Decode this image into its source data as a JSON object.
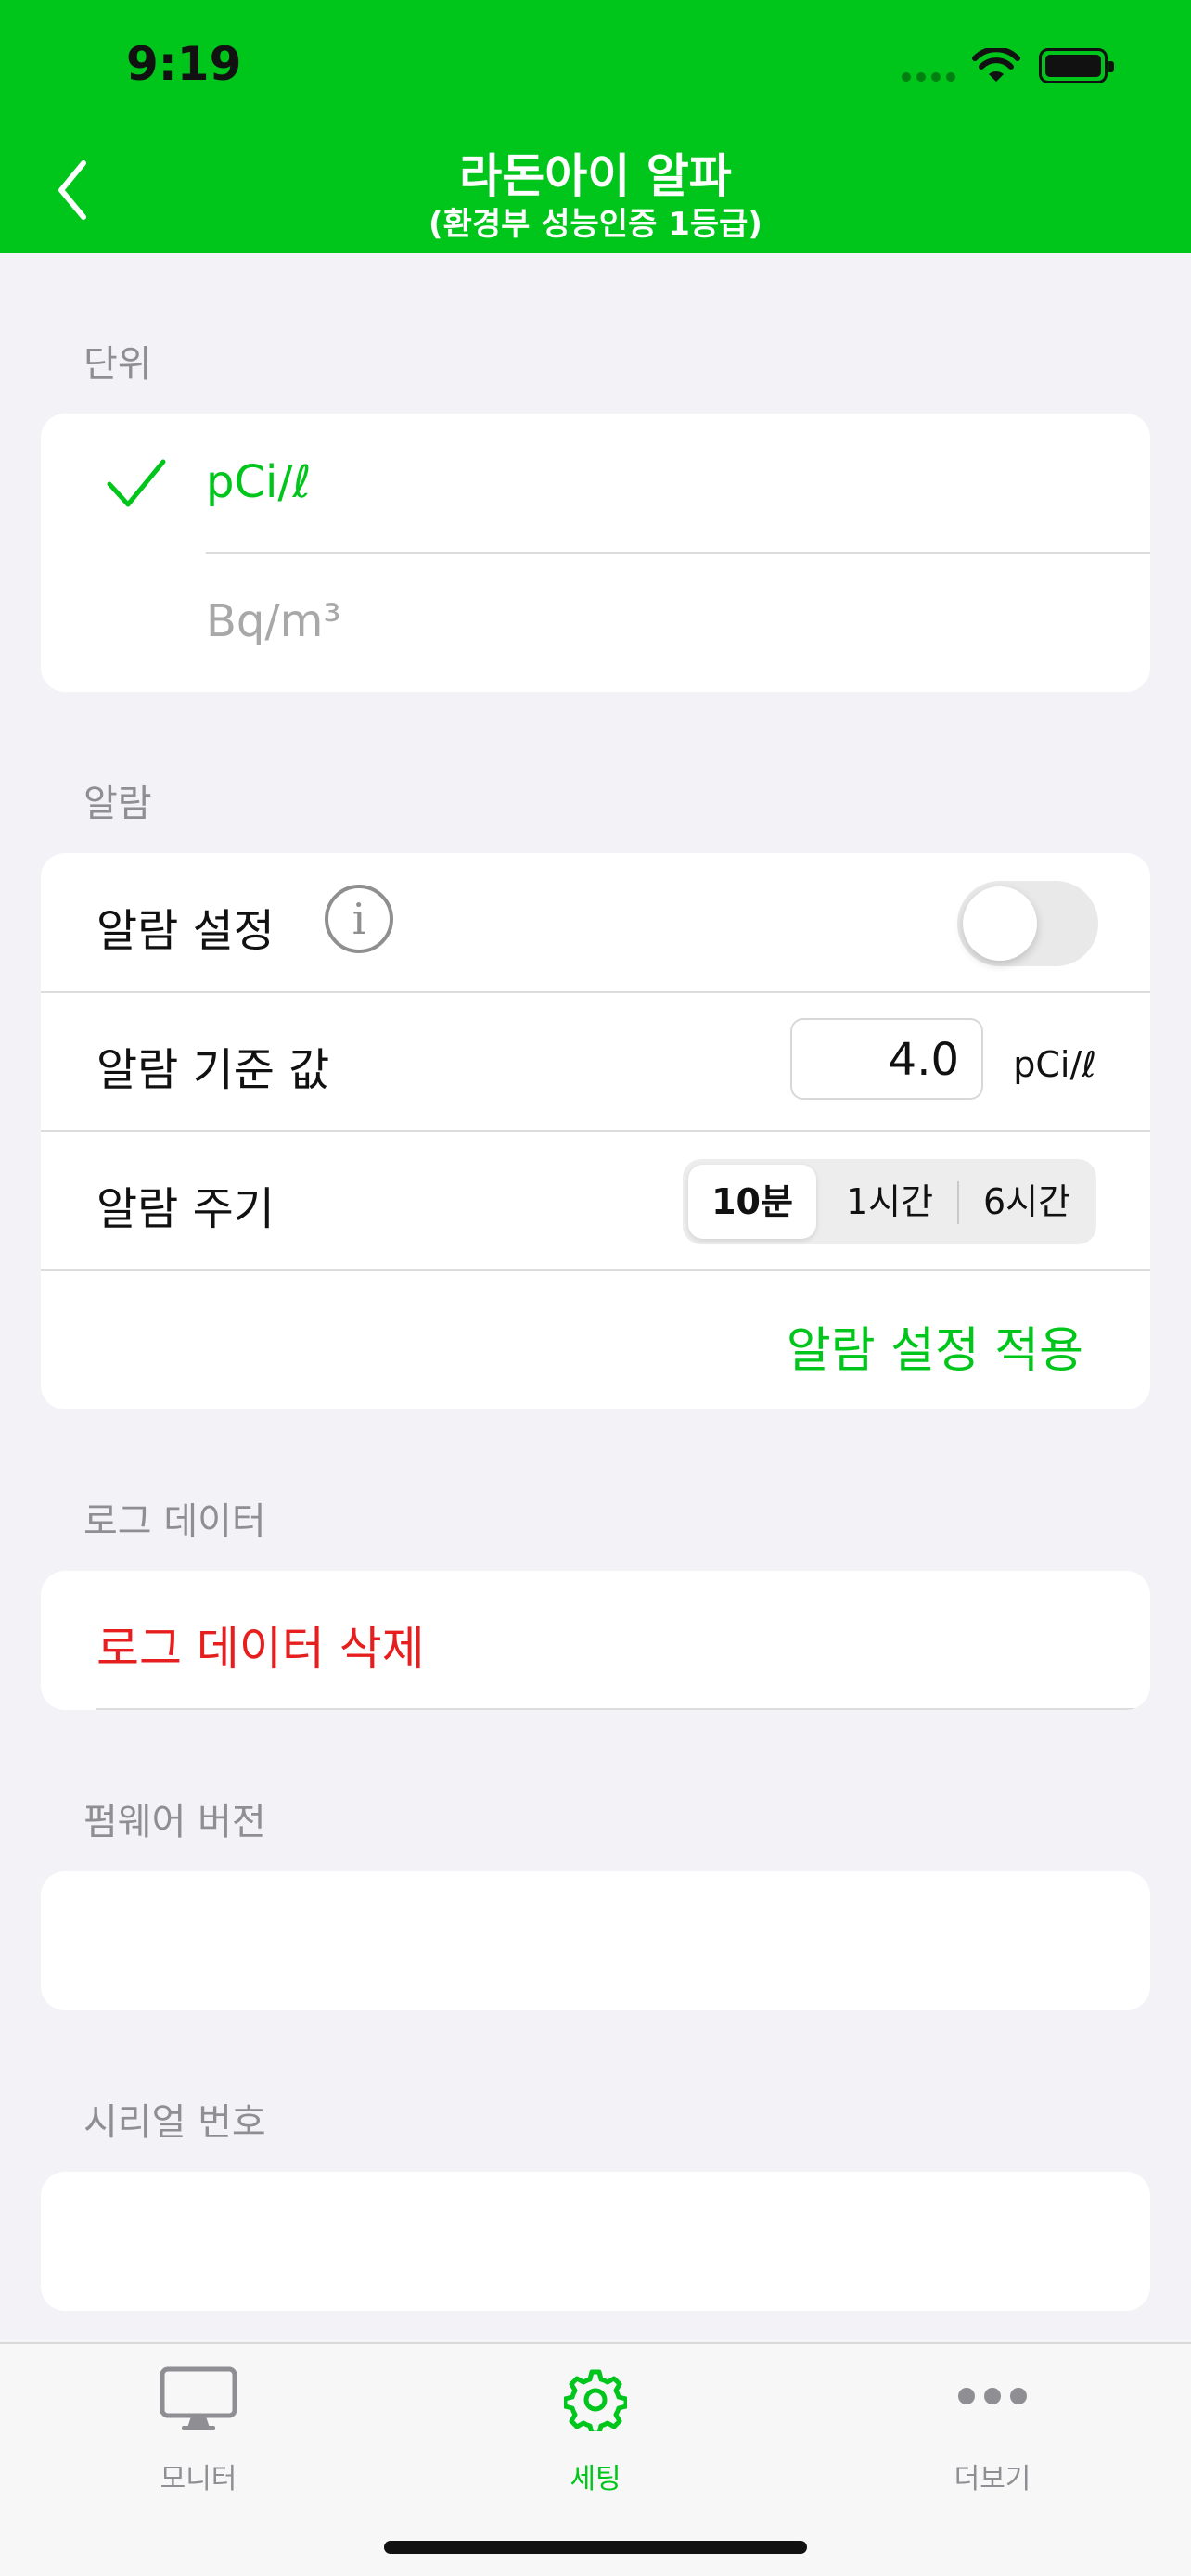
{
  "status_bar": {
    "time": "9:19"
  },
  "header": {
    "title": "라돈아이 알파",
    "subtitle": "(환경부 성능인증 1등급)"
  },
  "sections": {
    "unit": {
      "label": "단위",
      "options": [
        {
          "label": "pCi/ℓ",
          "selected": true
        },
        {
          "label": "Bq/m³",
          "selected": false
        }
      ]
    },
    "alarm": {
      "label": "알람",
      "setting_label": "알람 설정",
      "setting_on": false,
      "threshold_label": "알람 기준 값",
      "threshold_value": "4.0",
      "threshold_unit": "pCi/ℓ",
      "period_label": "알람 주기",
      "period_options": [
        "10분",
        "1시간",
        "6시간"
      ],
      "period_selected": "10분",
      "apply_label": "알람 설정 적용"
    },
    "log": {
      "label": "로그 데이터",
      "delete_label": "로그 데이터 삭제"
    },
    "firmware": {
      "label": "펌웨어 버전",
      "value": ""
    },
    "serial": {
      "label": "시리얼 번호",
      "value": ""
    }
  },
  "tabbar": {
    "items": [
      {
        "label": "모니터",
        "icon": "monitor-icon"
      },
      {
        "label": "세팅",
        "icon": "gear-icon",
        "active": true
      },
      {
        "label": "더보기",
        "icon": "more-icon"
      }
    ]
  },
  "colors": {
    "accent": "#00c51b",
    "danger": "#e61e1e",
    "background": "#f2f2f7"
  }
}
